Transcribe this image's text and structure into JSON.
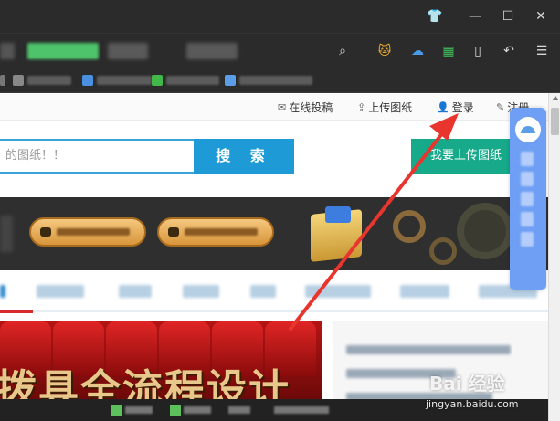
{
  "window": {
    "icons": [
      "shirt-icon",
      "minimize-icon",
      "maximize-icon",
      "close-icon"
    ],
    "icon_glyphs": [
      "👕",
      "—",
      "☐",
      "✕"
    ]
  },
  "toolbar": {
    "icons": [
      "search-icon",
      "extension-cat-icon",
      "cloud-icon",
      "apps-grid-icon",
      "phone-icon",
      "undo-icon",
      "menu-icon"
    ],
    "icon_glyphs": [
      "⌕",
      "🐱",
      "☁",
      "▦",
      "▯",
      "↶",
      "☰"
    ]
  },
  "topnav": {
    "submit": "在线投稿",
    "upload": "上传图纸",
    "login": "登录",
    "register": "注册"
  },
  "search": {
    "placeholder": "的图纸！！",
    "button": "搜 索",
    "upload_button": "我要上传图纸"
  },
  "hero": {
    "text": "拨具全流程设计"
  },
  "watermark": {
    "main": "Bai 经验",
    "url": "jingyan.baidu.com"
  },
  "colors": {
    "search_accent": "#1e9ad6",
    "upload_accent": "#16a98a",
    "annotation_arrow": "#e8362f",
    "float_widget": "#6e9ff5"
  }
}
